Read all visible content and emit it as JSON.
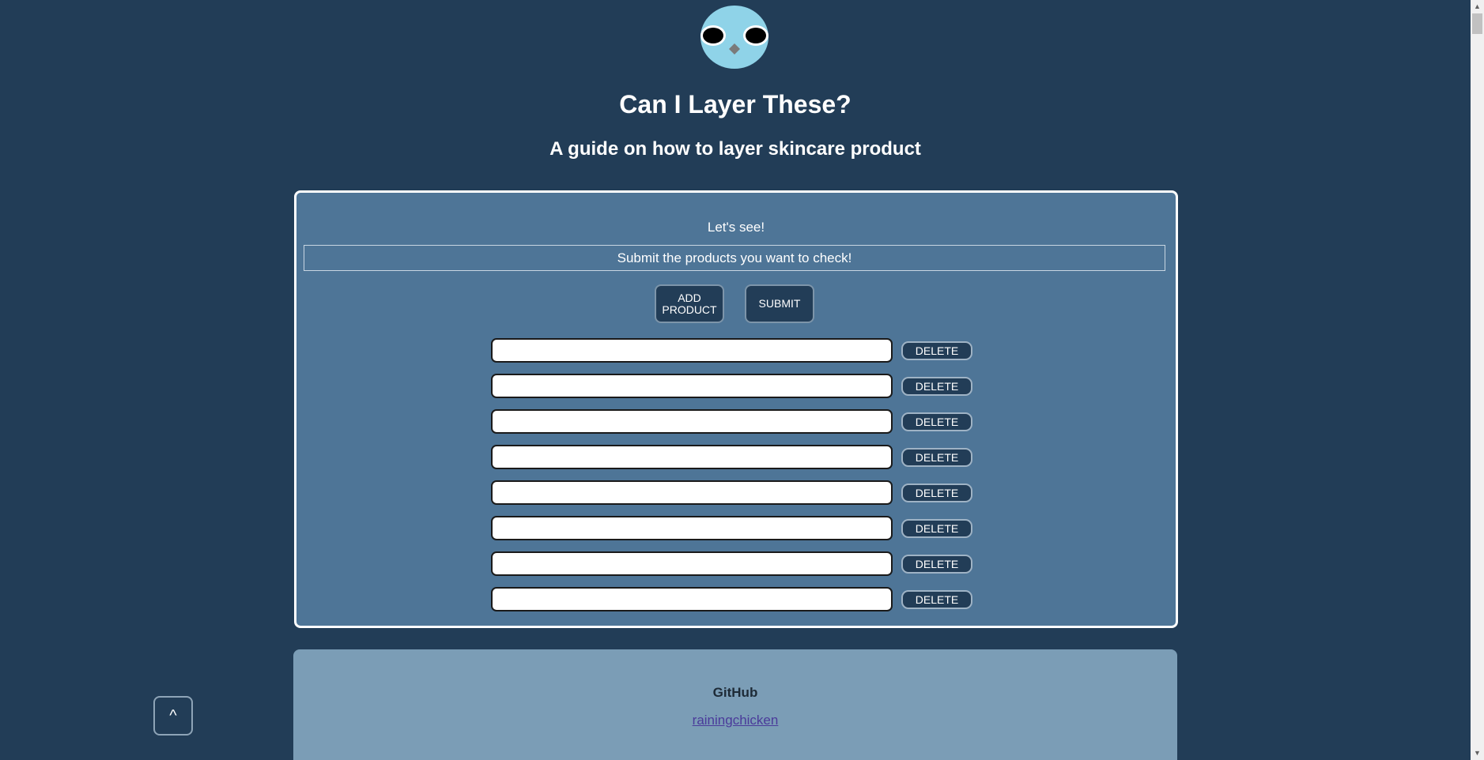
{
  "header": {
    "logo_icon": "bird-face-logo",
    "title": "Can I Layer These?",
    "subtitle": "A guide on how to layer skincare product"
  },
  "form": {
    "heading": "Let's see!",
    "instruction": "Submit the products you want to check!",
    "add_button": "ADD PRODUCT",
    "submit_button": "SUBMIT",
    "products": [
      {
        "value": "",
        "delete_label": "DELETE"
      },
      {
        "value": "",
        "delete_label": "DELETE"
      },
      {
        "value": "",
        "delete_label": "DELETE"
      },
      {
        "value": "",
        "delete_label": "DELETE"
      },
      {
        "value": "",
        "delete_label": "DELETE"
      },
      {
        "value": "",
        "delete_label": "DELETE"
      },
      {
        "value": "",
        "delete_label": "DELETE"
      },
      {
        "value": "",
        "delete_label": "DELETE"
      }
    ]
  },
  "footer": {
    "heading": "GitHub",
    "link_text": "rainingchicken"
  },
  "back_to_top": {
    "label": "^"
  },
  "colors": {
    "page_background": "#223d57",
    "card_background": "#4e7597",
    "footer_background": "#7b9db6",
    "button_background": "#223d57",
    "logo_face": "#8fd3e8"
  }
}
